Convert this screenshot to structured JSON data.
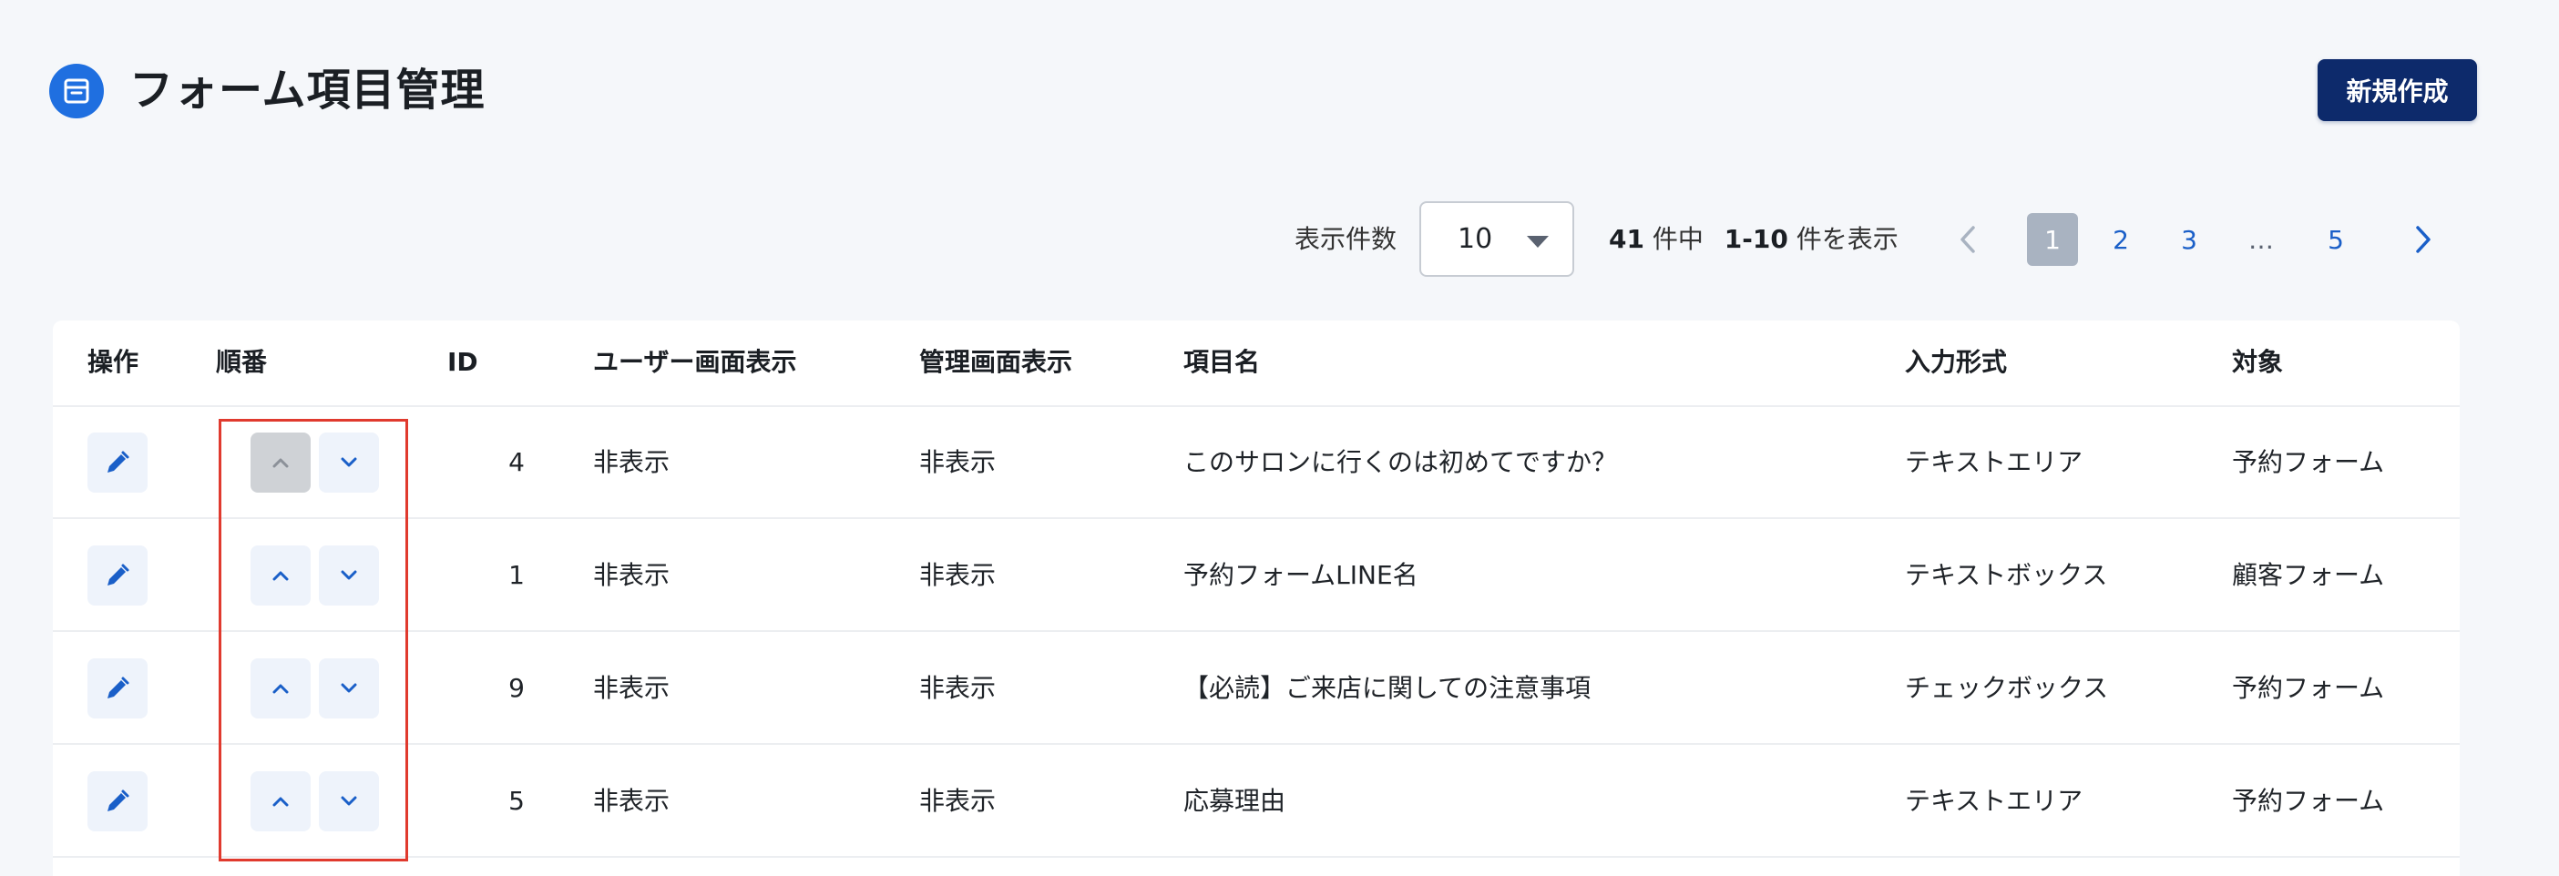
{
  "header": {
    "title": "フォーム項目管理",
    "new_button_label": "新規作成"
  },
  "toolbar": {
    "per_page_label": "表示件数",
    "per_page_value": "10",
    "total": "41",
    "total_suffix": "件中",
    "range": "1-10",
    "range_suffix": "件を表示"
  },
  "pagination": {
    "pages": [
      "1",
      "2",
      "3",
      "…",
      "5"
    ],
    "current_page": "1"
  },
  "table": {
    "columns": [
      "操作",
      "順番",
      "ID",
      "ユーザー画面表示",
      "管理画面表示",
      "項目名",
      "入力形式",
      "対象"
    ],
    "rows": [
      {
        "id": "4",
        "user_display": "非表示",
        "admin_display": "非表示",
        "item_name": "このサロンに行くのは初めてですか？",
        "input_type": "テキストエリア",
        "target": "予約フォーム",
        "up_disabled": true
      },
      {
        "id": "1",
        "user_display": "非表示",
        "admin_display": "非表示",
        "item_name": "予約フォームLINE名",
        "input_type": "テキストボックス",
        "target": "顧客フォーム",
        "up_disabled": false
      },
      {
        "id": "9",
        "user_display": "非表示",
        "admin_display": "非表示",
        "item_name": "【必読】ご来店に関しての注意事項",
        "input_type": "チェックボックス",
        "target": "予約フォーム",
        "up_disabled": false
      },
      {
        "id": "5",
        "user_display": "非表示",
        "admin_display": "非表示",
        "item_name": "応募理由",
        "input_type": "テキストエリア",
        "target": "予約フォーム",
        "up_disabled": false
      }
    ]
  },
  "colors": {
    "accent": "#1f6fe0",
    "primary_button": "#0d2a6b",
    "highlight": "#e03a2e"
  },
  "icons": {
    "header": "archive-box-icon",
    "edit": "pencil-icon",
    "move_up": "chevron-up-icon",
    "move_down": "chevron-down-icon",
    "prev": "chevron-left-icon",
    "next": "chevron-right-icon"
  }
}
